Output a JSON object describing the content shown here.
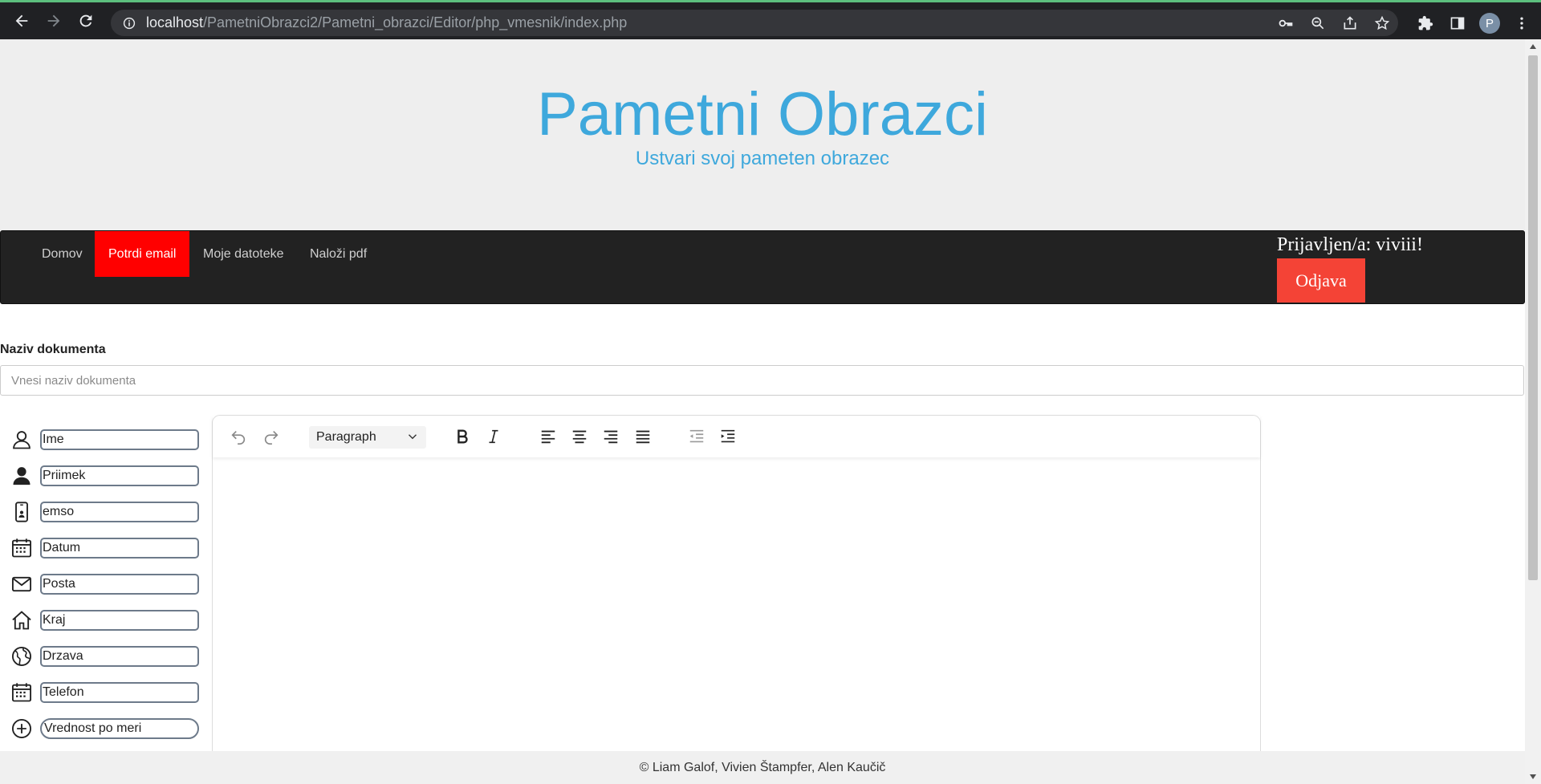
{
  "browser": {
    "url_host": "localhost",
    "url_path": "/PametniObrazci2/Pametni_obrazci/Editor/php_vmesnik/index.php",
    "profile_initial": "P"
  },
  "header": {
    "title": "Pametni Obrazci",
    "subtitle": "Ustvari svoj pameten obrazec"
  },
  "navbar": {
    "items": [
      {
        "label": "Domov",
        "active": false
      },
      {
        "label": "Potrdi email",
        "active": true
      },
      {
        "label": "Moje datoteke",
        "active": false
      },
      {
        "label": "Naloži pdf",
        "active": false
      }
    ],
    "login_text": "Prijavljen/a: viviii!",
    "logout_label": "Odjava",
    "active_color": "#ff0000",
    "logout_color": "#f44336"
  },
  "document": {
    "label": "Naziv dokumenta",
    "placeholder": "Vnesi naziv dokumenta"
  },
  "fields": [
    {
      "icon": "person-outline-icon",
      "placeholder": "Ime"
    },
    {
      "icon": "person-filled-icon",
      "placeholder": "Priimek"
    },
    {
      "icon": "phone-id-icon",
      "placeholder": "emso"
    },
    {
      "icon": "calendar-icon",
      "placeholder": "Datum"
    },
    {
      "icon": "envelope-icon",
      "placeholder": "Posta"
    },
    {
      "icon": "house-icon",
      "placeholder": "Kraj"
    },
    {
      "icon": "globe-icon",
      "placeholder": "Drzava"
    },
    {
      "icon": "calendar-icon",
      "placeholder": "Telefon"
    },
    {
      "icon": "plus-circle-icon",
      "placeholder": "Vrednost po meri"
    }
  ],
  "editor": {
    "block_format": "Paragraph"
  },
  "footer": {
    "text": "© Liam Galof, Vivien Štampfer, Alen Kaučič"
  },
  "colors": {
    "title_blue": "#3ea8dc",
    "header_bg": "#eeeeee",
    "navbar_bg": "#222222"
  }
}
